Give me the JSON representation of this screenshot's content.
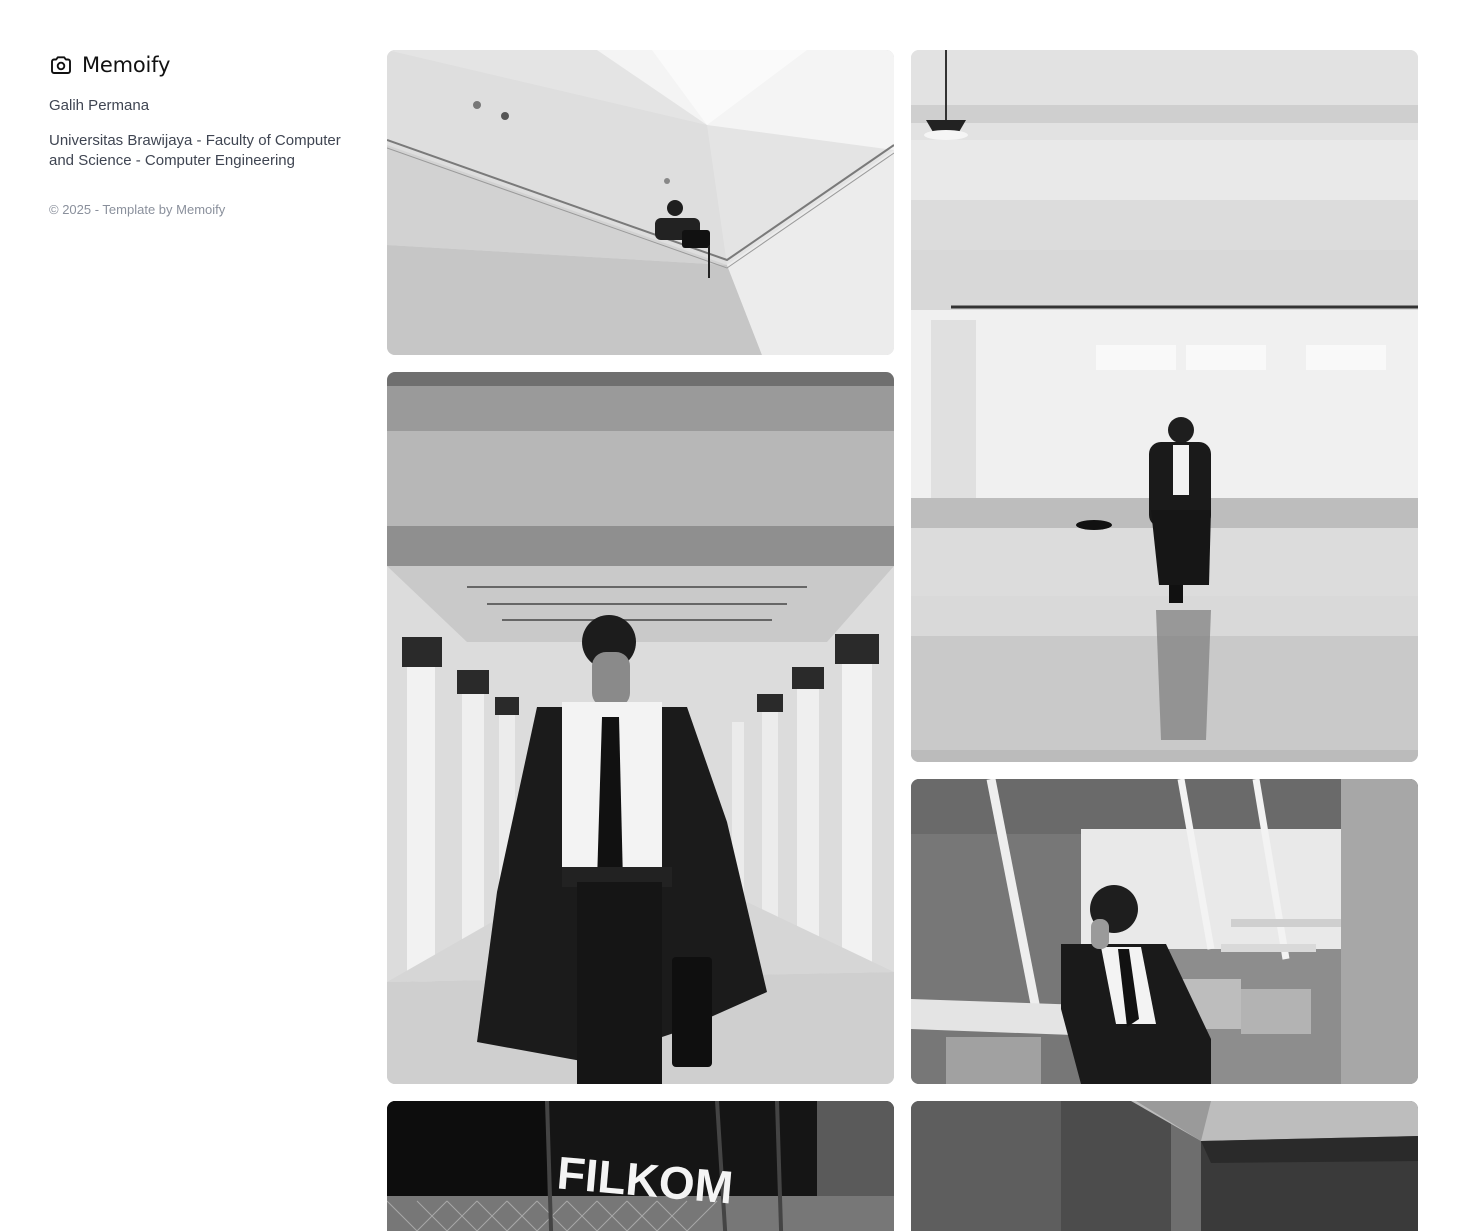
{
  "brand": {
    "name": "Memoify",
    "icon": "camera-icon"
  },
  "profile": {
    "author": "Galih Permana",
    "affiliation": "Universitas Brawijaya - Faculty of Computer and Science - Computer Engineering"
  },
  "footer": {
    "copyright": "© 2025 - Template by Memoify"
  },
  "gallery": {
    "sign_text": "FILKOM"
  }
}
